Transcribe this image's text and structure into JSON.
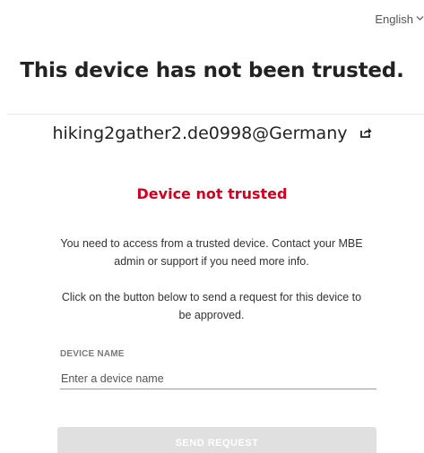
{
  "language": {
    "label": "English",
    "icon": "chevron-down-icon"
  },
  "page": {
    "title": "This device has not been trusted.",
    "account": "hiking2gather2.de0998@Germany",
    "account_icon": "external-link-icon"
  },
  "notice": {
    "heading": "Device not trusted",
    "heading_color": "#d1001f",
    "message1": "You need to access from a trusted device. Contact your MBE admin or support if you need more info.",
    "message2": "Click on the button below to send a request for this device to be approved."
  },
  "form": {
    "device_name_label": "DEVICE NAME",
    "device_name_placeholder": "Enter a device name",
    "device_name_value": "",
    "send_label": "SEND REQUEST",
    "send_disabled": true
  }
}
